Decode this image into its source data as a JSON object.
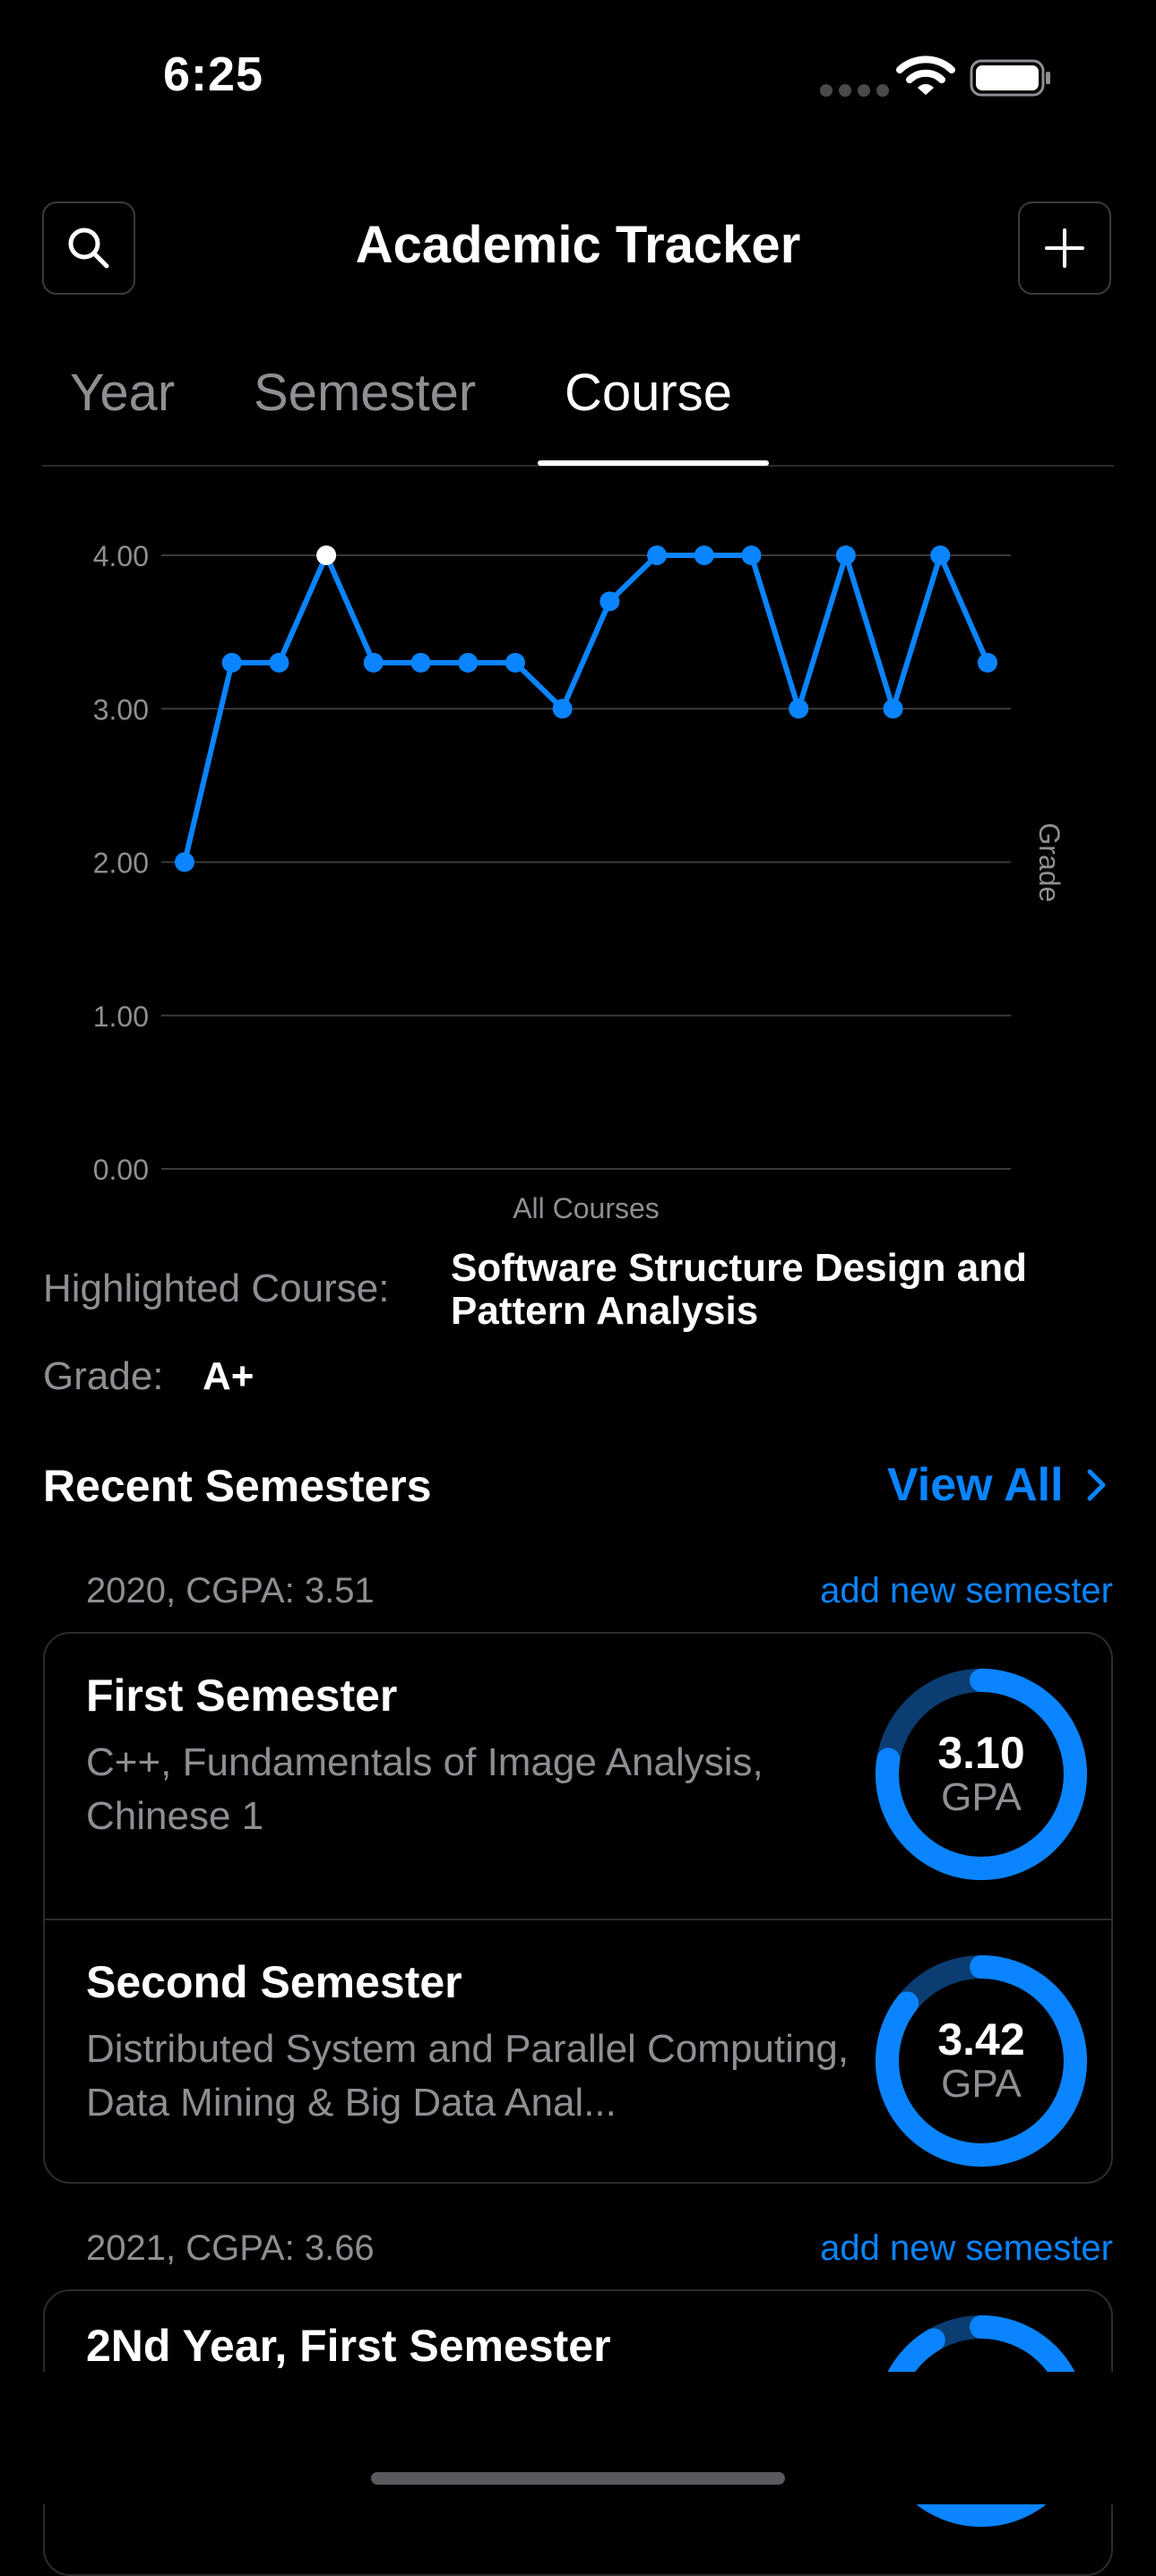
{
  "status_bar": {
    "time": "6:25"
  },
  "header": {
    "title": "Academic Tracker"
  },
  "tabs": [
    {
      "label": "Year",
      "active": false
    },
    {
      "label": "Semester",
      "active": false
    },
    {
      "label": "Course",
      "active": true
    }
  ],
  "colors": {
    "accent": "#0a84ff",
    "ring_track": "#0b3d73",
    "highlight_point": "#ffffff"
  },
  "chart_data": {
    "type": "line",
    "xlabel": "All Courses",
    "ylabel": "Grade",
    "ylim": [
      0,
      4
    ],
    "yticks": [
      "0.00",
      "1.00",
      "2.00",
      "3.00",
      "4.00"
    ],
    "grid": true,
    "series": [
      {
        "values": [
          2.0,
          3.3,
          3.3,
          4.0,
          3.3,
          3.3,
          3.3,
          3.3,
          3.0,
          3.7,
          4.0,
          4.0,
          4.0,
          3.0,
          4.0,
          3.0,
          4.0,
          3.3
        ]
      }
    ],
    "highlighted_index": 3
  },
  "highlight": {
    "label": "Highlighted Course:",
    "course": "Software Structure Design and Pattern Analysis",
    "grade_label": "Grade:",
    "grade": "A+"
  },
  "recent": {
    "title": "Recent Semesters",
    "view_all": "View All",
    "groups": [
      {
        "heading": "2020, CGPA: 3.51",
        "link": "add new semester",
        "semesters": [
          {
            "name": "First Semester",
            "courses": "C++, Fundamentals of Image Analysis, Chinese 1",
            "gpa": "3.10",
            "gpa_label": "GPA",
            "fraction": 0.775
          },
          {
            "name": "Second Semester",
            "courses": "Distributed System and Parallel Computing, Data Mining & Big Data Anal...",
            "gpa": "3.42",
            "gpa_label": "GPA",
            "fraction": 0.855
          }
        ]
      },
      {
        "heading": "2021, CGPA: 3.66",
        "link": "add new semester",
        "semesters": [
          {
            "name": "2Nd Year, First Semester",
            "fraction": 0.915
          }
        ]
      }
    ]
  }
}
